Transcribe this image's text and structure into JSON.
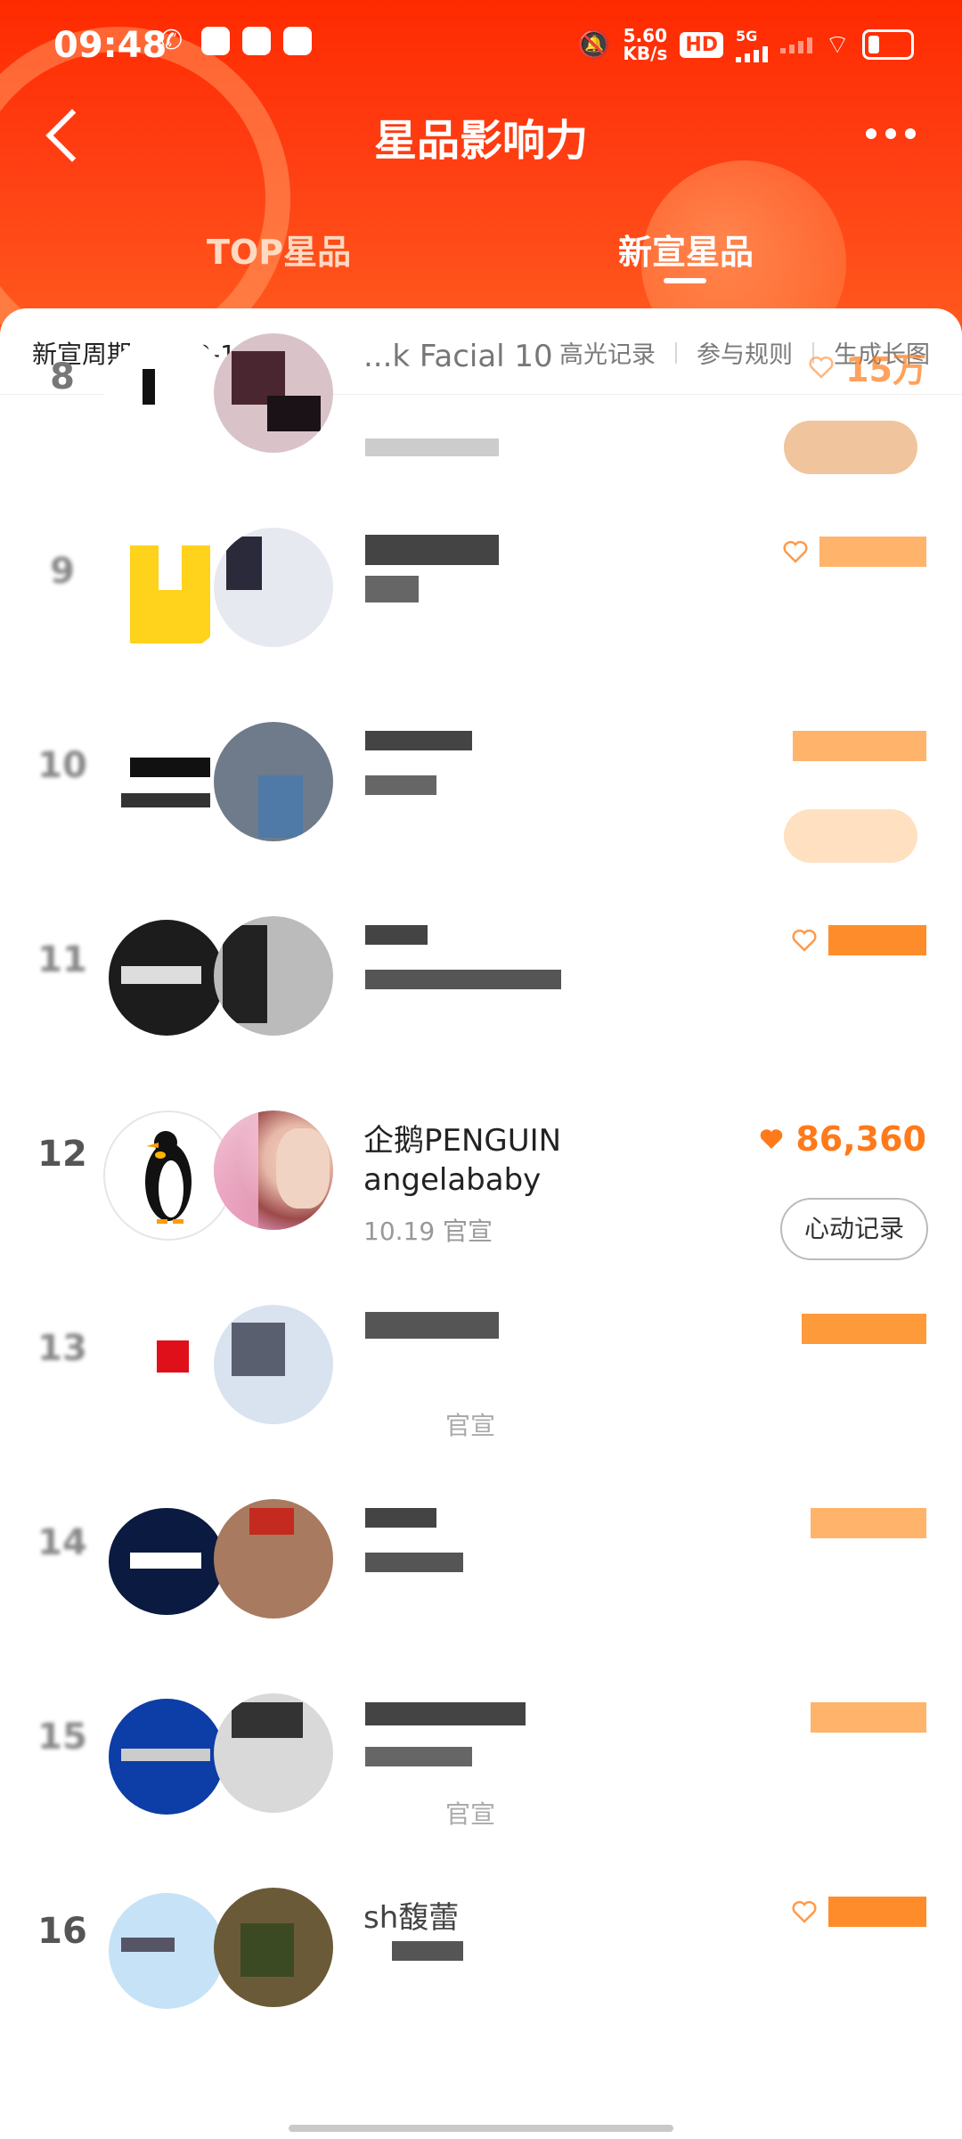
{
  "status_bar": {
    "time": "09:48",
    "net_speed": "5.60",
    "net_unit": "KB/s",
    "hd_badge": "HD",
    "network_type": "5G"
  },
  "header": {
    "title": "星品影响力",
    "tabs": [
      {
        "label": "TOP星品",
        "active": false
      },
      {
        "label": "新宣星品",
        "active": true
      }
    ]
  },
  "subbar": {
    "week": "新宣周期 10.19-10.25",
    "links": [
      "高光记录",
      "参与规则",
      "生成长图"
    ]
  },
  "rows": [
    {
      "rank": "8",
      "name1": "...k Facial 10",
      "name2": "",
      "date": "",
      "likes": "15万",
      "blurred": true
    },
    {
      "rank": "9",
      "name1": "",
      "name2": "",
      "date": "",
      "likes": "",
      "blurred": true
    },
    {
      "rank": "10",
      "name1": "",
      "name2": "",
      "date": "",
      "likes": "",
      "blurred": true
    },
    {
      "rank": "11",
      "name1": "",
      "name2": "",
      "date": "",
      "likes": "",
      "blurred": true
    },
    {
      "rank": "12",
      "name1": "企鹅PENGUIN",
      "name2": "angelababy",
      "date": "10.19 官宣",
      "likes": "86,360",
      "button": "心动记录",
      "blurred": false
    },
    {
      "rank": "13",
      "name1": "",
      "name2": "",
      "date": "官宣",
      "likes": "",
      "blurred": true
    },
    {
      "rank": "14",
      "name1": "",
      "name2": "",
      "date": "",
      "likes": "",
      "blurred": true
    },
    {
      "rank": "15",
      "name1": "",
      "name2": "",
      "date": "官宣",
      "likes": "",
      "blurred": true
    },
    {
      "rank": "16",
      "name1": "sh馥蕾",
      "name2": "",
      "date": "",
      "likes": "",
      "blurred": true
    }
  ],
  "colors": {
    "header_red": "#ff2a00",
    "accent_orange": "#ff7a1a"
  },
  "icons": {
    "back": "chevron-left-icon",
    "more": "more-dots-icon",
    "heart": "heart-icon"
  }
}
